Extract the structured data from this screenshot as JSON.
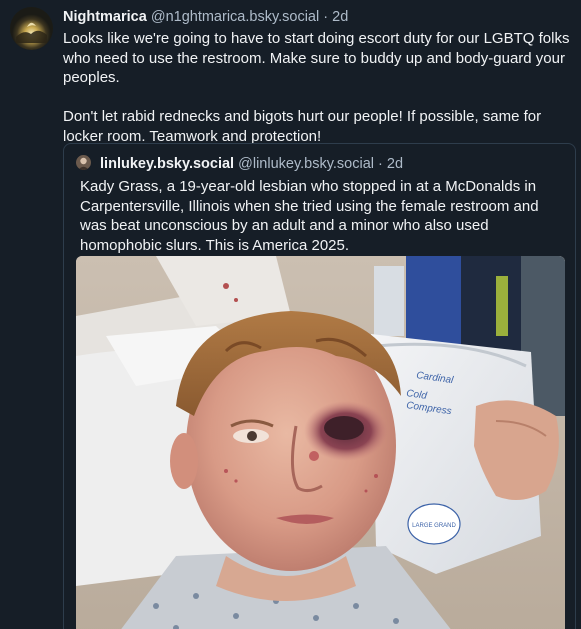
{
  "post": {
    "display_name": "Nightmarica",
    "handle": "@n1ghtmarica.bsky.social",
    "separator": "·",
    "age": "2d",
    "paragraphs": [
      "Looks like we're going to have to start doing escort duty for our LGBTQ folks who need to use the restroom.  Make sure to buddy up and body-guard your peoples.",
      "Don't let rabid rednecks and bigots hurt our people!  If possible, same for locker room.  Teamwork and protection!"
    ]
  },
  "quote": {
    "display_name": "linlukey.bsky.social",
    "handle": "@linlukey.bsky.social",
    "separator": "·",
    "age": "2d",
    "text": "Kady Grass, a 19-year-old lesbian who stopped in at a McDonalds in Carpentersville, Illinois when she tried using the female restroom and was beat unconscious by an adult and a minor who also used homophobic slurs. This is America 2025.",
    "image_labels": {
      "pack_brand": "Cardinal",
      "pack_line1": "Cold",
      "pack_line2": "Compress",
      "pack_size": "LARGE GRAND"
    }
  }
}
